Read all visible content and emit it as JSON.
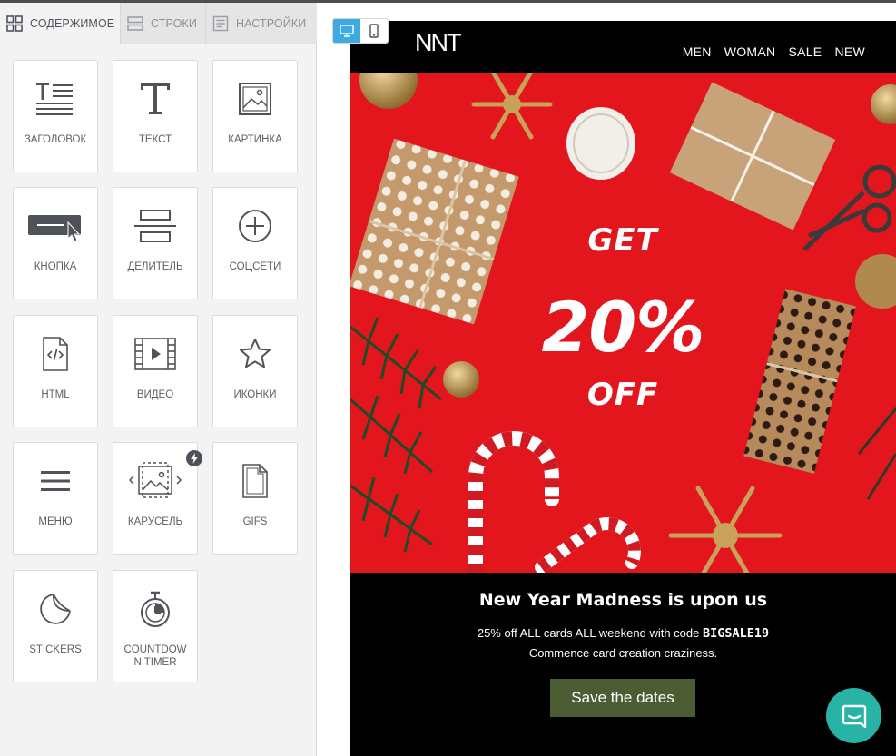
{
  "tabs": [
    {
      "label": "СОДЕРЖИМОЕ",
      "icon": "grid-icon",
      "active": true
    },
    {
      "label": "СТРОКИ",
      "icon": "rows-icon",
      "active": false
    },
    {
      "label": "НАСТРОЙКИ",
      "icon": "settings-doc-icon",
      "active": false
    }
  ],
  "tiles": [
    {
      "label": "ЗАГОЛОВОК",
      "icon": "heading-icon"
    },
    {
      "label": "ТЕКСТ",
      "icon": "text-icon"
    },
    {
      "label": "КАРТИНКА",
      "icon": "image-icon"
    },
    {
      "label": "КНОПКА",
      "icon": "button-icon"
    },
    {
      "label": "ДЕЛИТЕЛЬ",
      "icon": "divider-icon"
    },
    {
      "label": "СОЦСЕТИ",
      "icon": "social-plus-icon"
    },
    {
      "label": "HTML",
      "icon": "html-file-icon"
    },
    {
      "label": "ВИДЕО",
      "icon": "video-icon"
    },
    {
      "label": "ИКОНКИ",
      "icon": "star-icon"
    },
    {
      "label": "МЕНЮ",
      "icon": "menu-icon"
    },
    {
      "label": "КАРУСЕЛЬ",
      "icon": "carousel-icon"
    },
    {
      "label": "GIFS",
      "icon": "gif-file-icon"
    },
    {
      "label": "STICKERS",
      "icon": "sticker-icon"
    },
    {
      "label": "COUNTDOWN TIMER",
      "icon": "stopwatch-icon"
    }
  ],
  "device_toggle": {
    "desktop_icon": "desktop-icon",
    "mobile_icon": "mobile-icon",
    "selected": "desktop"
  },
  "email": {
    "logo": "NNT",
    "nav": [
      "MEN",
      "WOMAN",
      "SALE",
      "NEW"
    ],
    "hero": {
      "line1": "GET",
      "line2": "20%",
      "line3": "OFF"
    },
    "headline": "New Year Madness is upon us",
    "promo_text": "25% off ALL cards ALL weekend with code",
    "promo_code": "BIGSALE19",
    "subline": "Commence card creation craziness.",
    "cta": "Save the dates"
  },
  "chat_icon": "chat-bubble-icon",
  "colors": {
    "accent": "#3fa9e2",
    "hero_red": "#e3161d",
    "cta_green": "#4c5d33",
    "chat_teal": "#27b3a5"
  }
}
